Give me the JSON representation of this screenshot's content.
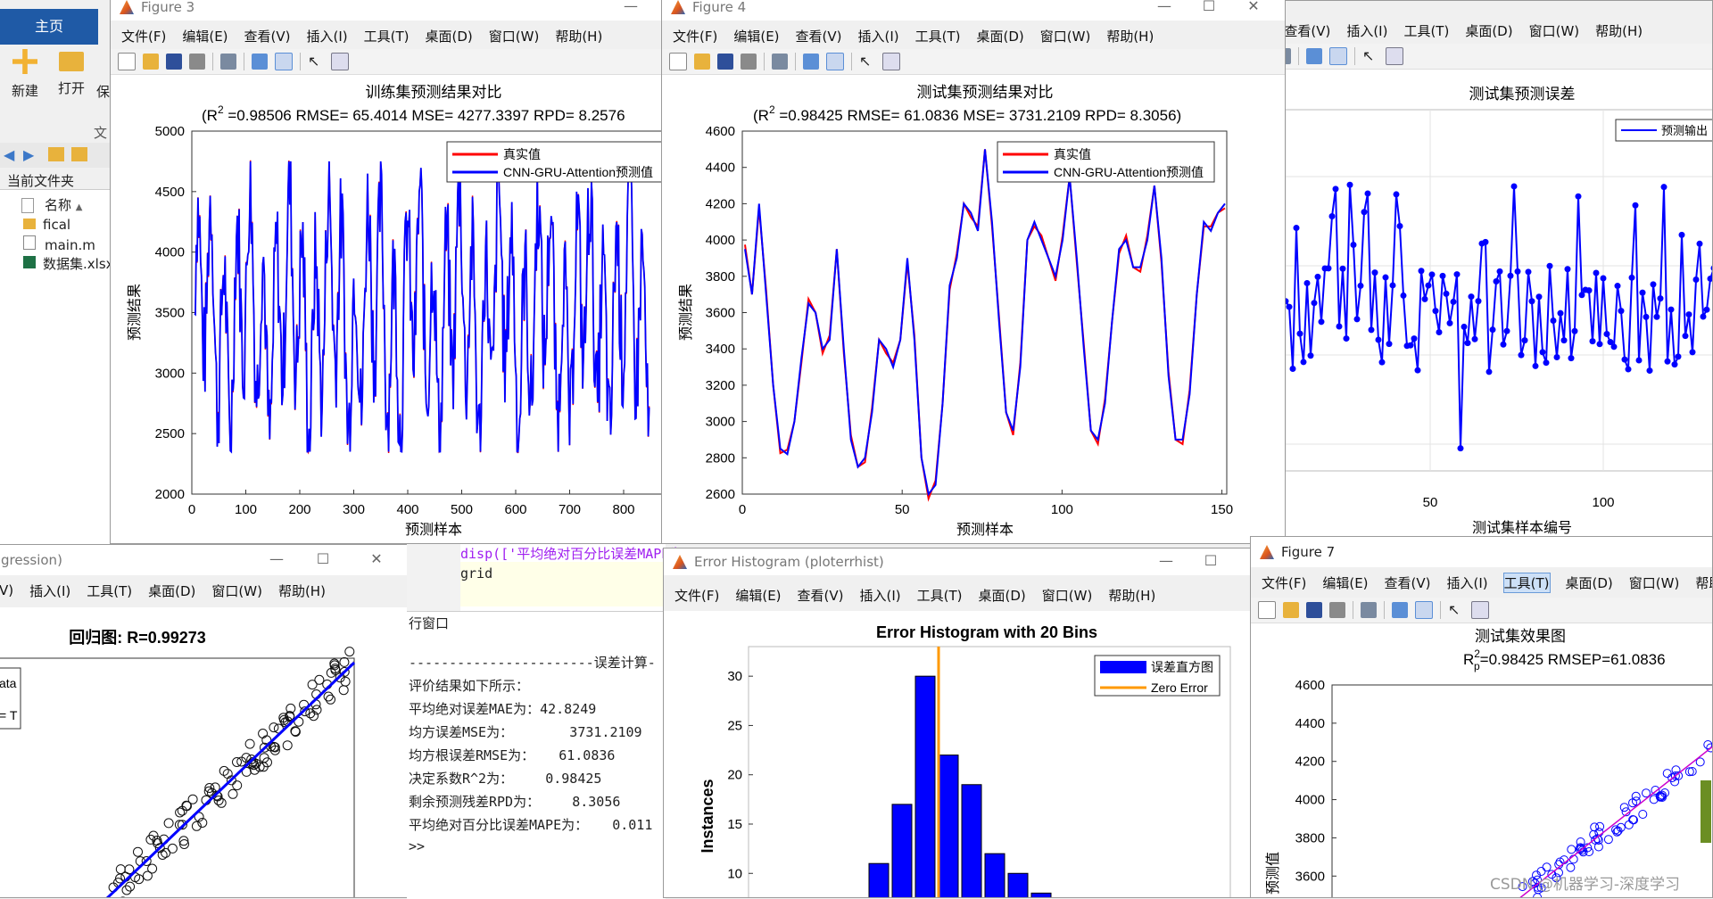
{
  "colors": {
    "red": "#ff0000",
    "blue": "#0000ff",
    "orange": "#ff9900",
    "magenta": "#cc00cc"
  },
  "matlab": {
    "home_tab": "主页",
    "new_label": "新建",
    "open_label": "打开",
    "save_label": "保",
    "file_label": "文",
    "current_folder": "当前文件夹",
    "name_col": "名称",
    "files": [
      "fical",
      "main.m",
      "数据集.xlsx"
    ]
  },
  "menus": {
    "items": [
      "文件(F)",
      "编辑(E)",
      "查看(V)",
      "插入(I)",
      "工具(T)",
      "桌面(D)",
      "窗口(W)",
      "帮助(H)"
    ]
  },
  "fig3": {
    "window_title": "Figure 3",
    "title": "训练集预测结果对比",
    "subtitle_pre": "(R",
    "subtitle_post": " =0.98506 RMSE= 65.4014 MSE= 4277.3397 RPD= 8.2576",
    "ylabel": "预测结果",
    "xlabel": "预测样本",
    "legend": [
      "真实值",
      "CNN-GRU-Attention预测值"
    ],
    "xticks": [
      "0",
      "100",
      "200",
      "300",
      "400",
      "500",
      "600",
      "700",
      "800"
    ],
    "yticks": [
      "2000",
      "2500",
      "3000",
      "3500",
      "4000",
      "4500",
      "5000"
    ]
  },
  "fig4": {
    "window_title": "Figure 4",
    "title": "测试集预测结果对比",
    "subtitle_pre": "(R",
    "subtitle_post": " =0.98425 RMSE= 61.0836 MSE= 3731.2109 RPD= 8.3056)",
    "ylabel": "预测结果",
    "xlabel": "预测样本",
    "legend": [
      "真实值",
      "CNN-GRU-Attention预测值"
    ],
    "xticks": [
      "0",
      "50",
      "100",
      "150"
    ],
    "yticks": [
      "2600",
      "2800",
      "3000",
      "3200",
      "3400",
      "3600",
      "3800",
      "4000",
      "4200",
      "4400",
      "4600"
    ]
  },
  "fig5": {
    "title": "测试集预测误差",
    "xlabel": "测试集样本编号",
    "legend": [
      "预测输出"
    ],
    "xticks": [
      "50",
      "100"
    ]
  },
  "fig_reg": {
    "window_title": "gression)",
    "title": "回归图: R=0.99273",
    "legend": [
      "ata",
      "= T"
    ]
  },
  "editor": {
    "line1": "disp(['平均绝对百分比误差MAPE为",
    "line2": "grid"
  },
  "cmdwin": {
    "title": "行窗口",
    "lines": [
      "-----------------------误差计算-",
      "评价结果如下所示：",
      "平均绝对误差MAE为：42.8249",
      "均方误差MSE为：       3731.2109",
      "均方根误差RMSE为：   61.0836",
      "决定系数R^2为：    0.98425",
      "剩余预测残差RPD为：    8.3056",
      "平均绝对百分比误差MAPE为：   0.011",
      ">>"
    ]
  },
  "hist": {
    "window_title": "Error Histogram (ploterrhist)",
    "title": "Error Histogram with 20 Bins",
    "ylabel": "Instances",
    "legend": [
      "误差直方图",
      "Zero Error"
    ],
    "yticks": [
      "10",
      "15",
      "20",
      "25",
      "30"
    ],
    "bins": [
      0,
      0,
      0,
      0,
      0,
      0,
      0,
      0,
      11,
      17,
      30,
      22,
      19,
      12,
      10,
      8
    ]
  },
  "fig7": {
    "window_title": "Figure 7",
    "title": "测试集效果图",
    "metric_pre": "R",
    "metric_sub": "p",
    "metric_post": "=0.98425  RMSEP=61.0836",
    "ylabel": "预测值",
    "yticks": [
      "3600",
      "3800",
      "4000",
      "4200",
      "4400",
      "4600"
    ]
  },
  "watermark": "CSDN @机器学习-深度学习"
}
